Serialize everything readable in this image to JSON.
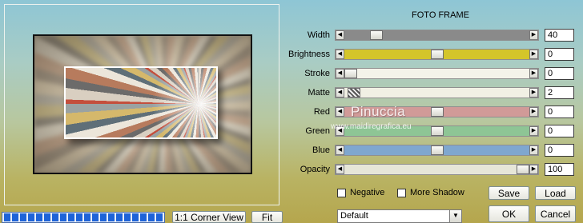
{
  "dialog": {
    "title": "FOTO FRAME"
  },
  "sliders": [
    {
      "label": "Width",
      "value": "40",
      "position": 0.15,
      "track_color": "#8a8a8a"
    },
    {
      "label": "Brightness",
      "value": "0",
      "position": 0.5,
      "track_color": "#d4c52a"
    },
    {
      "label": "Stroke",
      "value": "0",
      "position": 0.0,
      "track_color": "#f4f3ea"
    },
    {
      "label": "Matte",
      "value": "2",
      "position": 0.02,
      "track_color": "#f1f0e4"
    },
    {
      "label": "Red",
      "value": "0",
      "position": 0.5,
      "track_color": "#d19a98"
    },
    {
      "label": "Green",
      "value": "0",
      "position": 0.5,
      "track_color": "#8ec595"
    },
    {
      "label": "Blue",
      "value": "0",
      "position": 0.5,
      "track_color": "#7fa7cf"
    },
    {
      "label": "Opacity",
      "value": "100",
      "position": 1.0,
      "track_color": "#e6e6d8"
    }
  ],
  "options": {
    "negative": {
      "label": "Negative",
      "checked": false
    },
    "more_shadow": {
      "label": "More Shadow",
      "checked": false
    }
  },
  "buttons": {
    "save": "Save",
    "load": "Load",
    "ok": "OK",
    "cancel": "Cancel",
    "corner_view": "1:1 Corner View",
    "fit": "Fit"
  },
  "preset": {
    "selected": "Default"
  },
  "watermark": {
    "name": "Pinuccia",
    "url": "www.maidiregrafica.eu"
  },
  "progress": {
    "value": 1.0
  },
  "colors": {
    "progress_fill": "#1e63d8"
  }
}
